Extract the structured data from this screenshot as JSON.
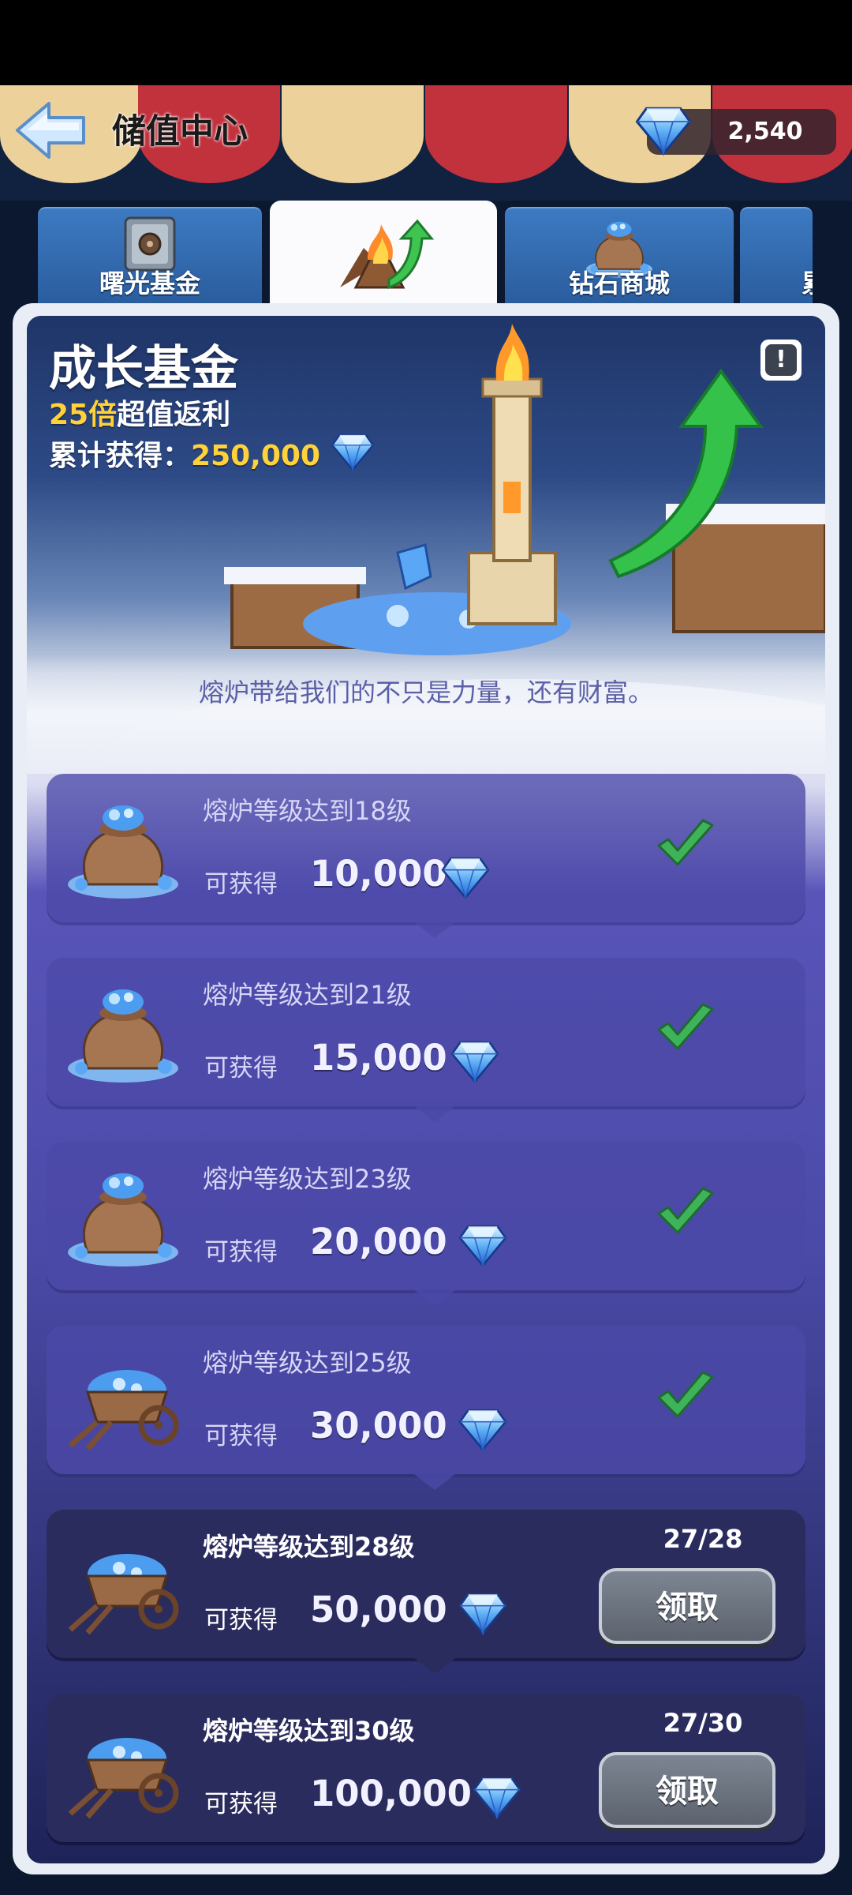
{
  "header": {
    "title": "储值中心",
    "currency_value": "2,540",
    "back_icon": "back-arrow-icon",
    "currency_icon": "diamond-icon"
  },
  "tabs": [
    {
      "label": "曙光基金",
      "icon": "safe-icon",
      "active": false
    },
    {
      "label": "",
      "icon": "furnace-growth-icon",
      "active": true
    },
    {
      "label": "钻石商城",
      "icon": "diamond-bag-icon",
      "active": false
    },
    {
      "label": "累",
      "icon": "",
      "active": false
    }
  ],
  "banner": {
    "title": "成长基金",
    "multiplier": "25倍",
    "multiplier_suffix": "超值返利",
    "total_label": "累计获得：",
    "total_value": "250,000",
    "info_label": "!",
    "tagline": "熔炉带给我们的不只是力量，还有财富。"
  },
  "rewards": [
    {
      "title": "熔炉等级达到18级",
      "label": "可获得",
      "amount": "10,000",
      "status": "claimed",
      "icon": "small-diamond-sack-icon"
    },
    {
      "title": "熔炉等级达到21级",
      "label": "可获得",
      "amount": "15,000",
      "status": "claimed",
      "icon": "two-diamond-sacks-icon"
    },
    {
      "title": "熔炉等级达到23级",
      "label": "可获得",
      "amount": "20,000",
      "status": "claimed",
      "icon": "diamond-sacks-pile-icon"
    },
    {
      "title": "熔炉等级达到25级",
      "label": "可获得",
      "amount": "30,000",
      "status": "claimed",
      "icon": "diamond-cart-icon"
    },
    {
      "title": "熔炉等级达到28级",
      "label": "可获得",
      "amount": "50,000",
      "status": "locked",
      "progress": "27/28",
      "button": "领取",
      "icon": "diamond-cart-sacks-icon"
    },
    {
      "title": "熔炉等级达到30级",
      "label": "可获得",
      "amount": "100,000",
      "status": "locked",
      "progress": "27/30",
      "button": "领取",
      "icon": "diamond-carts-large-icon"
    }
  ],
  "colors": {
    "accent_yellow": "#ffd23a",
    "check_green": "#3fb35a",
    "card_done": "#4c49a8",
    "card_open": "#2b2c5e"
  }
}
